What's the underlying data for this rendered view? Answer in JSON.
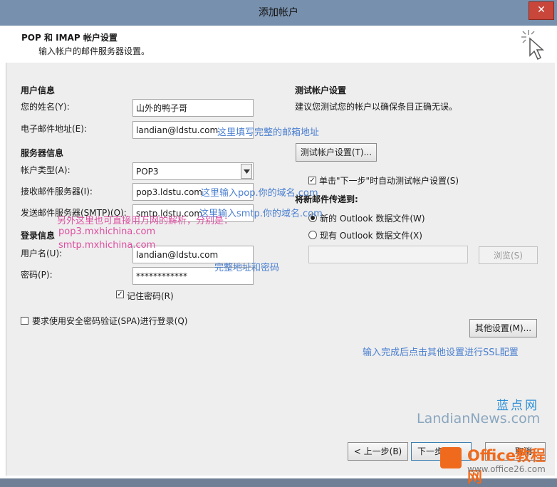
{
  "window": {
    "title": "添加帐户",
    "close_label": "✕"
  },
  "header": {
    "title": "POP 和 IMAP 帐户设置",
    "subtitle": "输入帐户的邮件服务器设置。"
  },
  "user_info": {
    "section": "用户信息",
    "name_label": "您的姓名(Y):",
    "name_value": "山外的鸭子哥",
    "email_label": "电子邮件地址(E):",
    "email_value": "landian@ldstu.com"
  },
  "server_info": {
    "section": "服务器信息",
    "type_label": "帐户类型(A):",
    "type_value": "POP3",
    "incoming_label": "接收邮件服务器(I):",
    "incoming_value": "pop3.ldstu.com",
    "outgoing_label": "发送邮件服务器(SMTP)(O):",
    "outgoing_value": "smtp.ldstu.com"
  },
  "login_info": {
    "section": "登录信息",
    "user_label": "用户名(U):",
    "user_value": "landian@ldstu.com",
    "password_label": "密码(P):",
    "password_value": "************",
    "remember_label": "记住密码(R)"
  },
  "spa_label": "要求使用安全密码验证(SPA)进行登录(Q)",
  "test": {
    "section": "测试帐户设置",
    "desc": "建议您测试您的帐户以确保条目正确无误。",
    "button": "测试帐户设置(T)...",
    "auto_label": "单击\"下一步\"时自动测试帐户设置(S)"
  },
  "deliver": {
    "section": "将新邮件传递到:",
    "new_label": "新的 Outlook 数据文件(W)",
    "existing_label": "现有 Outlook 数据文件(X)",
    "browse_label": "浏览(S)"
  },
  "more_settings_label": "其他设置(M)...",
  "annotations": {
    "email": "这里填写完整的邮箱地址",
    "pop": "这里输入pop.你的域名.com",
    "smtp": "这里输入smtp.你的域名.com",
    "alt1": "另外这里也可直接用万网的解析，分别是：",
    "alt2": "pop3.mxhichina.com",
    "alt3": "smtp.mxhichina.com",
    "full": "完整地址和密码",
    "ssl": "输入完成后点击其他设置进行SSL配置"
  },
  "footer": {
    "back_label": "< 上一步(B)",
    "next_label": "下一步(",
    "cancel_label": "取消"
  },
  "watermarks": {
    "cn": "蓝点网",
    "en": "LandianNews.com",
    "office1": "Office教程网",
    "office2": "www.office26.com"
  }
}
